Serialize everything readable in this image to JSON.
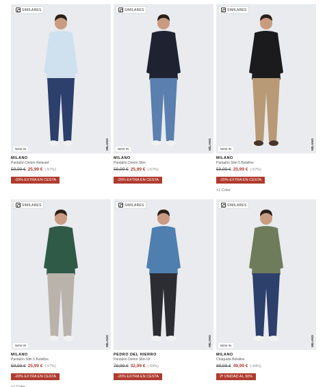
{
  "products": [
    {
      "similares": "SIMILARES",
      "badge": "NEW IN",
      "brand": "MILANO",
      "name": "Pantalón Denim Relaxed",
      "old_price": "59,99 €",
      "new_price": "25,99 €",
      "discount": "(-57%)",
      "promo": "-20% EXTRA EN CESTA",
      "colors": "",
      "bg": "#e9ebee",
      "top_color": "#cfe0ef",
      "pant_color": "#2d3f6b",
      "shoe_color": "#f2f2f2"
    },
    {
      "similares": "SIMILARES",
      "badge": "NEW IN",
      "brand": "MILANO",
      "name": "Pantalón Denim Slim",
      "old_price": "59,99 €",
      "new_price": "25,99 €",
      "discount": "(-57%)",
      "promo": "-20% EXTRA EN CESTA",
      "colors": "",
      "bg": "#e9ebee",
      "top_color": "#1f2230",
      "pant_color": "#5b7fae",
      "shoe_color": "#f2f2f2"
    },
    {
      "similares": "SIMILARES",
      "badge": "NEW IN",
      "brand": "MILANO",
      "name": "Pantalón Slim 5 Bolsillos",
      "old_price": "59,99 €",
      "new_price": "25,99 €",
      "discount": "(-57%)",
      "promo": "-20% EXTRA EN CESTA",
      "colors": "+1 Color",
      "bg": "#e9ebee",
      "top_color": "#1b1b1d",
      "pant_color": "#b89a76",
      "shoe_color": "#4a3428"
    },
    {
      "similares": "SIMILARES",
      "badge": "NEW IN",
      "brand": "MILANO",
      "name": "Pantalón Slim 5 Bolsillos",
      "old_price": "59,99 €",
      "new_price": "25,99 €",
      "discount": "(-57%)",
      "promo": "-20% EXTRA EN CESTA",
      "colors": "+1 Color",
      "bg": "#e9ebee",
      "top_color": "#2f5a47",
      "pant_color": "#b9b3ab",
      "shoe_color": "#f2f2f2"
    },
    {
      "similares": "SIMILARES",
      "badge": "",
      "brand": "PEDRO DEL HIERRO",
      "name": "Pantalón Denim Slim Fit",
      "old_price": "79,99 €",
      "new_price": "32,99 €",
      "discount": "(-59%)",
      "promo": "-20% EXTRA EN CESTA",
      "colors": "",
      "bg": "#e9ebee",
      "top_color": "#4f7fae",
      "pant_color": "#2b2d33",
      "shoe_color": "#f2f2f2"
    },
    {
      "similares": "SIMILARES",
      "badge": "NEW IN",
      "brand": "MILANO",
      "name": "Chaqueta Bolsillos",
      "old_price": "89,99 €",
      "new_price": "49,99 €",
      "discount": "(-44%)",
      "promo": "2ª UNIDAD AL 30%",
      "colors": "",
      "bg": "#e9ebee",
      "top_color": "#6f7c5c",
      "pant_color": "#2d3f6b",
      "shoe_color": "#f2f2f2"
    }
  ]
}
